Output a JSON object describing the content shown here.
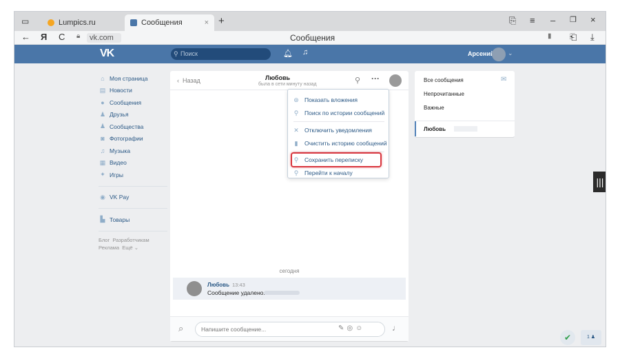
{
  "browser": {
    "tabs": [
      {
        "label": "Lumpics.ru",
        "favicon_color": "#f5a623"
      },
      {
        "label": "Сообщения",
        "favicon_color": "#4a76a8"
      }
    ],
    "new_tab": "+",
    "tab_close": "×",
    "nav": {
      "back": "←",
      "logo": "Я",
      "reload": "C"
    },
    "address": "vk.com",
    "page_title": "Сообщения",
    "window_controls": {
      "minimize": "–",
      "restore": "❐",
      "close": "×"
    }
  },
  "vk": {
    "logo": "VK",
    "search_placeholder": "Поиск",
    "user_name": "Арсений",
    "menu": [
      {
        "icon": "home-icon",
        "glyph": "⌂",
        "label": "Моя страница"
      },
      {
        "icon": "news-icon",
        "glyph": "▤",
        "label": "Новости"
      },
      {
        "icon": "messages-icon",
        "glyph": "●",
        "label": "Сообщения"
      },
      {
        "icon": "friends-icon",
        "glyph": "♟",
        "label": "Друзья"
      },
      {
        "icon": "groups-icon",
        "glyph": "♟",
        "label": "Сообщества"
      },
      {
        "icon": "photos-icon",
        "glyph": "◙",
        "label": "Фотографии"
      },
      {
        "icon": "music-icon",
        "glyph": "♫",
        "label": "Музыка"
      },
      {
        "icon": "video-icon",
        "glyph": "▦",
        "label": "Видео"
      },
      {
        "icon": "games-icon",
        "glyph": "✦",
        "label": "Игры"
      }
    ],
    "vkpay": "VK Pay",
    "goods": "Товары",
    "footer": {
      "blog": "Блог",
      "developers": "Разработчикам",
      "ads": "Реклама",
      "more": "Ещё ⌄"
    }
  },
  "conversation": {
    "back_label": "Назад",
    "peer_name": "Любовь",
    "peer_status": "была в сети минуту назад",
    "date_divider": "сегодня",
    "message": {
      "author": "Любовь",
      "time": "13:43",
      "text": "Сообщение удалено."
    },
    "input_placeholder": "Напишите сообщение..."
  },
  "dropdown": {
    "items": [
      {
        "icon": "attachments-icon",
        "glyph": "⊛",
        "label": "Показать вложения"
      },
      {
        "icon": "search-icon",
        "glyph": "⚲",
        "label": "Поиск по истории сообщений"
      },
      {
        "icon": "mute-icon",
        "glyph": "✕",
        "label": "Отключить уведомления"
      },
      {
        "icon": "trash-icon",
        "glyph": "▮",
        "label": "Очистить историю сообщений"
      },
      {
        "icon": "search-icon",
        "glyph": "⚲",
        "label": "Сохранить переписку"
      },
      {
        "icon": "search-icon",
        "glyph": "⚲",
        "label": "Перейти к началу"
      }
    ],
    "highlight_color": "#d9363e"
  },
  "right_panel": {
    "all": "Все сообщения",
    "unread": "Непрочитанные",
    "important": "Важные",
    "active_chat": "Любовь"
  },
  "widgets": {
    "online_count": "1 ♟"
  },
  "colors": {
    "vk_blue": "#4a76a8",
    "link": "#2a5885"
  }
}
